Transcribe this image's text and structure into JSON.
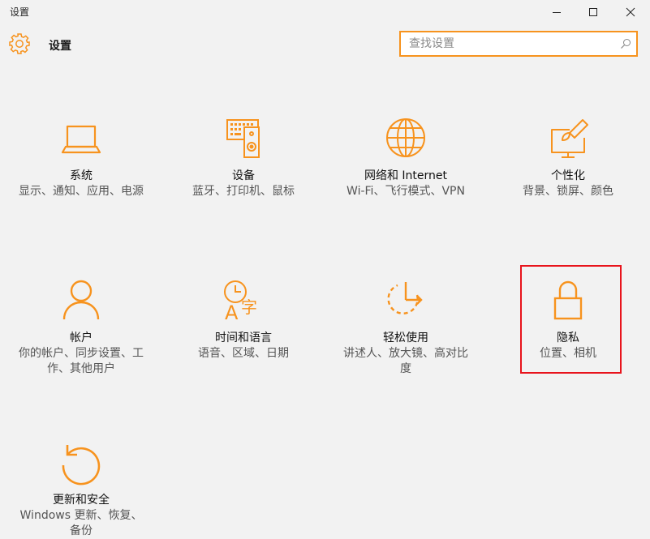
{
  "window": {
    "title": "设置"
  },
  "header": {
    "title": "设置"
  },
  "search": {
    "placeholder": "查找设置"
  },
  "accent": "#f7931e",
  "highlight_color": "#e8141c",
  "tiles": [
    {
      "name": "系统",
      "desc": "显示、通知、应用、电源",
      "icon": "laptop-icon"
    },
    {
      "name": "设备",
      "desc": "蓝牙、打印机、鼠标",
      "icon": "keyboard-speaker-icon"
    },
    {
      "name": "网络和 Internet",
      "desc": "Wi-Fi、飞行模式、VPN",
      "icon": "globe-icon"
    },
    {
      "name": "个性化",
      "desc": "背景、锁屏、颜色",
      "icon": "paint-brush-monitor-icon"
    },
    {
      "name": "帐户",
      "desc": "你的帐户、同步设置、工作、其他用户",
      "icon": "person-icon"
    },
    {
      "name": "时间和语言",
      "desc": "语音、区域、日期",
      "icon": "clock-language-icon"
    },
    {
      "name": "轻松使用",
      "desc": "讲述人、放大镜、高对比度",
      "icon": "ease-of-access-icon"
    },
    {
      "name": "隐私",
      "desc": "位置、相机",
      "icon": "lock-icon"
    },
    {
      "name": "更新和安全",
      "desc": "Windows 更新、恢复、备份",
      "icon": "refresh-icon"
    }
  ]
}
